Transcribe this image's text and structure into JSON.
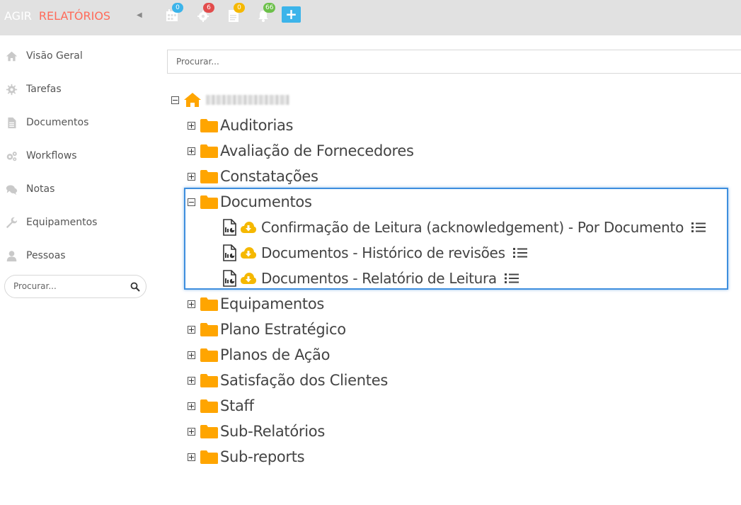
{
  "topbar": {
    "brand": "AGIR",
    "section": "RELATÓRIOS",
    "icons": [
      {
        "name": "calendar-icon",
        "badge": "0",
        "badge_color": "#3cb4ea"
      },
      {
        "name": "gear-icon",
        "badge": "6",
        "badge_color": "#e24c4c"
      },
      {
        "name": "document-icon",
        "badge": "0",
        "badge_color": "#f5b800"
      },
      {
        "name": "bell-icon",
        "badge": "66",
        "badge_color": "#6cc04a"
      }
    ]
  },
  "sidebar": {
    "items": [
      {
        "label": "Visão Geral",
        "icon": "home-icon"
      },
      {
        "label": "Tarefas",
        "icon": "gear-icon"
      },
      {
        "label": "Documentos",
        "icon": "file-icon"
      },
      {
        "label": "Workflows",
        "icon": "cogs-icon"
      },
      {
        "label": "Notas",
        "icon": "comments-icon"
      },
      {
        "label": "Equipamentos",
        "icon": "wrench-icon"
      },
      {
        "label": "Pessoas",
        "icon": "user-icon"
      }
    ],
    "search_placeholder": "Procurar..."
  },
  "main": {
    "search_placeholder": "Procurar...",
    "tree": {
      "folders_before": [
        "Auditorias",
        "Avaliação de Fornecedores",
        "Constatações"
      ],
      "expanded_folder": "Documentos",
      "reports": [
        "Confirmação de Leitura (acknowledgement) - Por Documento",
        "Documentos - Histórico de revisões",
        "Documentos - Relatório de Leitura"
      ],
      "folders_after": [
        "Equipamentos",
        "Plano Estratégico",
        "Planos de Ação",
        "Satisfação dos Clientes",
        "Staff",
        "Sub-Relatórios",
        "Sub-reports"
      ]
    }
  },
  "colors": {
    "folder": "#ffa500",
    "highlight": "#3e8ede",
    "accent": "#ff6b5a"
  }
}
